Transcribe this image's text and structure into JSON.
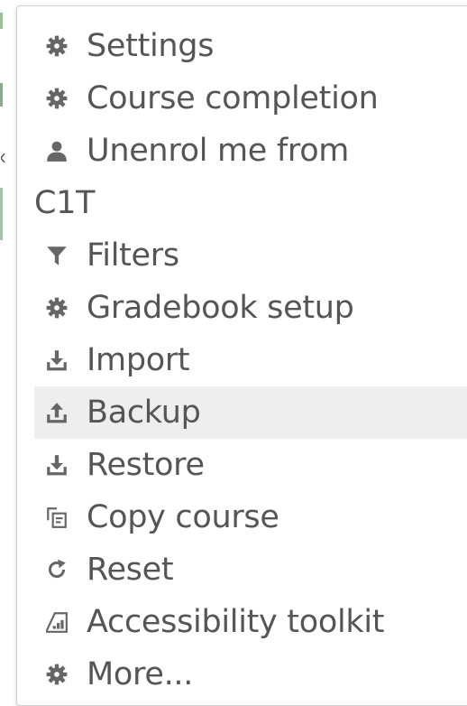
{
  "menu": {
    "items": [
      {
        "label": "Settings",
        "icon": "gear-icon"
      },
      {
        "label": "Course completion",
        "icon": "gear-icon"
      },
      {
        "label_line1": "Unenrol me from",
        "label_line2": "C1T",
        "icon": "user-icon"
      },
      {
        "label": "Filters",
        "icon": "filter-icon"
      },
      {
        "label": "Gradebook setup",
        "icon": "gear-icon"
      },
      {
        "label": "Import",
        "icon": "download-icon"
      },
      {
        "label": "Backup",
        "icon": "upload-icon",
        "active": true
      },
      {
        "label": "Restore",
        "icon": "download-icon"
      },
      {
        "label": "Copy course",
        "icon": "copy-icon"
      },
      {
        "label": "Reset",
        "icon": "reset-icon"
      },
      {
        "label": "Accessibility toolkit",
        "icon": "accessibility-toolkit-icon"
      },
      {
        "label": "More...",
        "icon": "gear-icon"
      }
    ]
  },
  "colors": {
    "text": "#555555",
    "icon": "#666666",
    "active_bg": "#eeeeee",
    "border": "#cfcfcf"
  }
}
